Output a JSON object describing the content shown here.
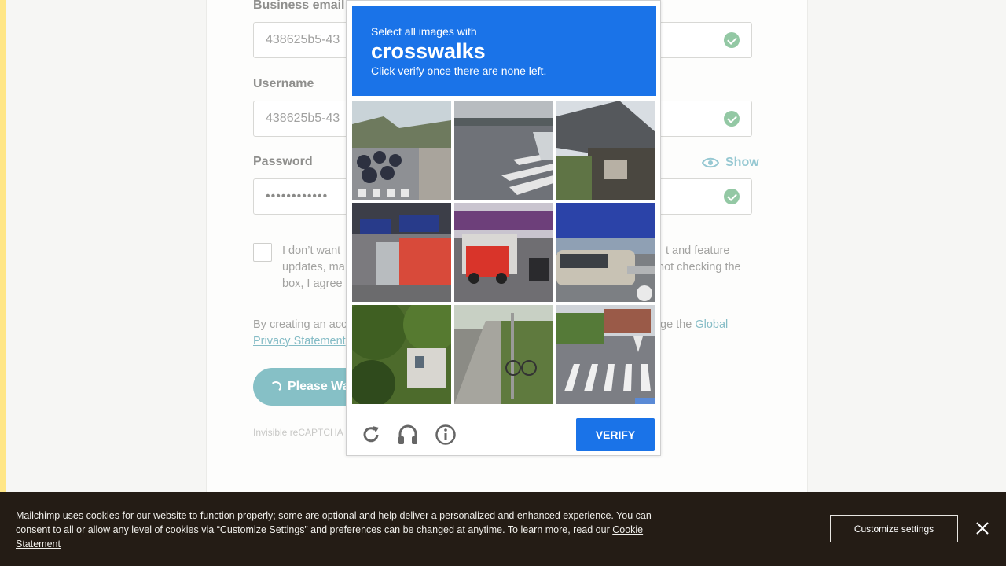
{
  "form": {
    "email": {
      "label": "Business email",
      "value": "438625b5-43"
    },
    "username": {
      "label": "Username",
      "value": "438625b5-43"
    },
    "password": {
      "label": "Password",
      "value": "••••••••••••",
      "show_label": "Show"
    },
    "consent": {
      "line1_left": "I don’t want",
      "line1_right": "t and feature",
      "line2_left": "updates, ma",
      "line2_right": "not checking the",
      "line3_left": "box, I agree"
    },
    "terms": {
      "line1_left": "By creating an acc",
      "line1_right": "ge the",
      "global_link": "Global",
      "privacy_link": "Privacy Statement"
    },
    "submit_label": "Please Wa",
    "recaptcha_note": "Invisible reCAPTCHA"
  },
  "captcha": {
    "instruction": "Select all images with",
    "target": "crosswalks",
    "hint": "Click verify once there are none left.",
    "verify_label": "VERIFY",
    "tiles": [
      "motorcycles-street-crosswalk",
      "road-crosswalk",
      "building-roof",
      "motorcycles-barrier",
      "red-truck-street",
      "car-billboard",
      "tree-house",
      "sidewalk-bicycle",
      "road-crosswalk-houses"
    ]
  },
  "cookie": {
    "text_part1": "Mailchimp uses cookies for our website to function properly; some are optional and help deliver a personalized and enhanced experience. You can consent to all or allow any level of cookies via “Customize Settings” and preferences can be changed at anytime. To learn more, read our",
    "link": "Cookie Statement",
    "customize_label": "Customize settings"
  },
  "colors": {
    "captcha_blue": "#1a73e8",
    "cookie_bg": "#241c15",
    "accent_teal": "#86c0c6",
    "check_green": "#93c8a4"
  }
}
